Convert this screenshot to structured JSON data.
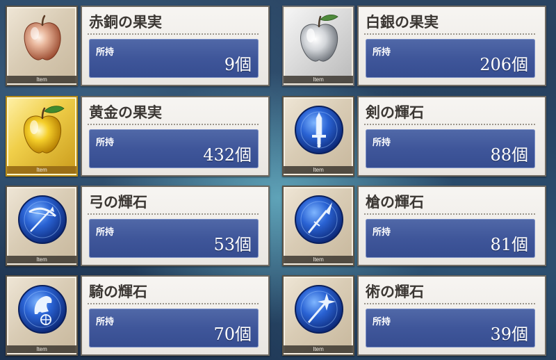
{
  "owned_label": "所持",
  "item_tag": "Item",
  "items": [
    {
      "name": "赤銅の果実",
      "count": "9個",
      "icon": "copper-apple-icon"
    },
    {
      "name": "白銀の果実",
      "count": "206個",
      "icon": "silver-apple-icon"
    },
    {
      "name": "黄金の果実",
      "count": "432個",
      "icon": "golden-apple-icon"
    },
    {
      "name": "剣の輝石",
      "count": "88個",
      "icon": "saber-gem-icon"
    },
    {
      "name": "弓の輝石",
      "count": "53個",
      "icon": "archer-gem-icon"
    },
    {
      "name": "槍の輝石",
      "count": "81個",
      "icon": "lancer-gem-icon"
    },
    {
      "name": "騎の輝石",
      "count": "70個",
      "icon": "rider-gem-icon"
    },
    {
      "name": "術の輝石",
      "count": "39個",
      "icon": "caster-gem-icon"
    }
  ],
  "colors": {
    "panel_blue": "#3f569a",
    "gold_frame": "#f0cf4a",
    "gem_blue": "#2a63d4"
  }
}
